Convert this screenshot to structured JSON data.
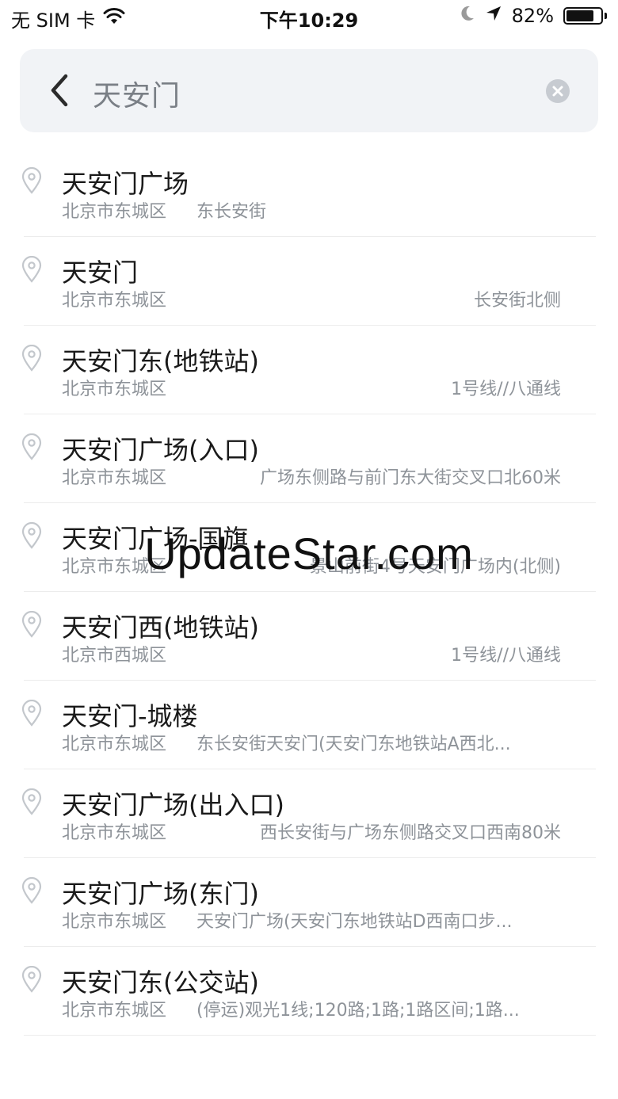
{
  "status_bar": {
    "carrier": "无 SIM 卡",
    "time": "下午10:29",
    "battery_percent": "82%",
    "battery_level": 0.82,
    "icons": [
      "wifi-icon",
      "moon-icon",
      "location-arrow-icon",
      "battery-icon"
    ]
  },
  "search": {
    "query": "天安门",
    "icons": [
      "back-chevron-icon",
      "clear-icon"
    ]
  },
  "results": [
    {
      "title": "天安门广场",
      "district": "北京市东城区",
      "detail": "东长安街",
      "align": "left"
    },
    {
      "title": "天安门",
      "district": "北京市东城区",
      "detail": "长安街北侧",
      "align": "right"
    },
    {
      "title": "天安门东(地铁站)",
      "district": "北京市东城区",
      "detail": "1号线//八通线",
      "align": "right"
    },
    {
      "title": "天安门广场(入口)",
      "district": "北京市东城区",
      "detail": "广场东侧路与前门东大街交叉口北60米",
      "align": "right"
    },
    {
      "title": "天安门广场-国旗",
      "district": "北京市东城区",
      "detail": "景山前街4号天安门广场内(北侧)",
      "align": "right"
    },
    {
      "title": "天安门西(地铁站)",
      "district": "北京市西城区",
      "detail": "1号线//八通线",
      "align": "right"
    },
    {
      "title": "天安门-城楼",
      "district": "北京市东城区",
      "detail": "东长安街天安门(天安门东地铁站A西北...",
      "align": "left"
    },
    {
      "title": "天安门广场(出入口)",
      "district": "北京市东城区",
      "detail": "西长安街与广场东侧路交叉口西南80米",
      "align": "right"
    },
    {
      "title": "天安门广场(东门)",
      "district": "北京市东城区",
      "detail": "天安门广场(天安门东地铁站D西南口步...",
      "align": "left"
    },
    {
      "title": "天安门东(公交站)",
      "district": "北京市东城区",
      "detail": "(停运)观光1线;120路;1路;1路区间;1路...",
      "align": "left"
    }
  ],
  "watermark": "UpdateStar.com",
  "colors": {
    "search_bg": "#f1f3f6",
    "secondary_text": "#8e9399",
    "divider": "#ececec"
  }
}
